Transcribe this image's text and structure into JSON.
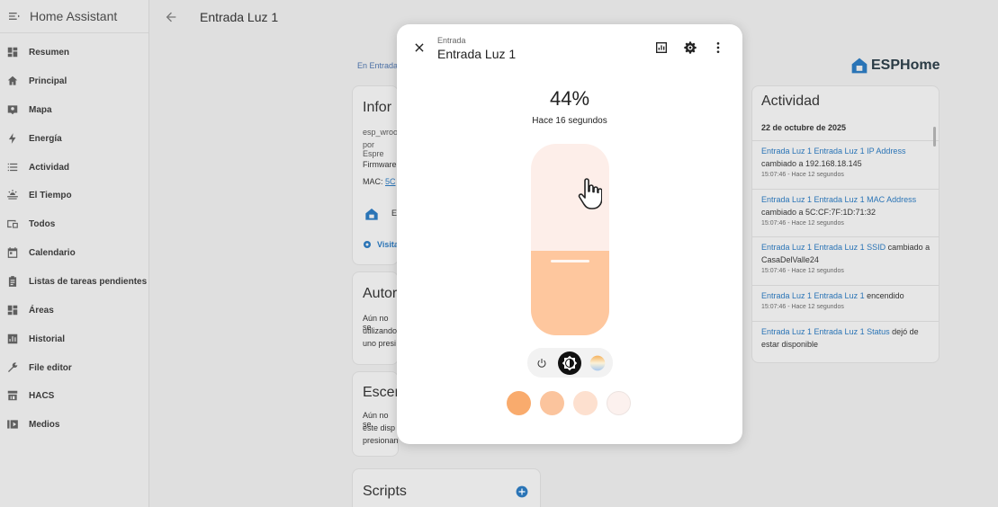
{
  "app": {
    "title": "Home Assistant",
    "page_title": "Entrada Luz 1"
  },
  "sidebar": {
    "items": [
      {
        "label": "Resumen",
        "icon": "dashboard-icon"
      },
      {
        "label": "Principal",
        "icon": "home-icon"
      },
      {
        "label": "Mapa",
        "icon": "map-icon"
      },
      {
        "label": "Energía",
        "icon": "lightning-icon"
      },
      {
        "label": "Actividad",
        "icon": "list-icon"
      },
      {
        "label": "El Tiempo",
        "icon": "weather-icon"
      },
      {
        "label": "Todos",
        "icon": "devices-icon"
      },
      {
        "label": "Calendario",
        "icon": "calendar-icon"
      },
      {
        "label": "Listas de tareas pendientes",
        "icon": "clipboard-icon"
      },
      {
        "label": "Áreas",
        "icon": "grid-icon"
      },
      {
        "label": "Historial",
        "icon": "chart-icon"
      },
      {
        "label": "File editor",
        "icon": "wrench-icon"
      },
      {
        "label": "HACS",
        "icon": "store-icon"
      },
      {
        "label": "Medios",
        "icon": "media-icon"
      }
    ]
  },
  "background": {
    "breadcrumb": "En Entrada",
    "info_card": {
      "title": "Infor",
      "line1": "esp_wroo",
      "line2": "por Espre",
      "firmware_label": "Firmware",
      "mac_label": "MAC:",
      "mac_value": "5C",
      "device_label": "E",
      "visit_label": "Visita"
    },
    "automations_card": {
      "title": "Autor",
      "lines": [
        "Aún no se",
        "utilizando",
        "uno presi"
      ]
    },
    "scenes_card": {
      "title": "Escer",
      "lines": [
        "Aún no se",
        "este disp",
        "presionan"
      ]
    },
    "scripts_card": {
      "title": "Scripts"
    },
    "brand": "ESPHome",
    "activity": {
      "title": "Actividad",
      "date": "22 de octubre de 2025",
      "entries": [
        {
          "link": "Entrada Luz 1 Entrada Luz 1 IP Address",
          "text": "cambiado a 192.168.18.145",
          "time": "15:07:46 - Hace 12 segundos"
        },
        {
          "link": "Entrada Luz 1 Entrada Luz 1 MAC Address",
          "text": "cambiado a 5C:CF:7F:1D:71:32",
          "time": "15:07:46 - Hace 12 segundos"
        },
        {
          "link": "Entrada Luz 1 Entrada Luz 1 SSID",
          "text": "cambiado a CasaDelValle24",
          "time": "15:07:46 - Hace 12 segundos"
        },
        {
          "link": "Entrada Luz 1 Entrada Luz 1",
          "text": "encendido",
          "time": "15:07:46 - Hace 12 segundos"
        },
        {
          "link": "Entrada Luz 1 Entrada Luz 1 Status",
          "text": "dejó de estar disponible",
          "time": ""
        }
      ]
    }
  },
  "dialog": {
    "subtitle": "Entrada",
    "title": "Entrada Luz 1",
    "brightness_text": "44%",
    "brightness_fraction": 0.44,
    "last_changed": "Hace 16 segundos",
    "slider_track_color": "#fdeee9",
    "slider_fill_color": "#fec79e",
    "swatches": [
      "#f9ab6d",
      "#fbc49d",
      "#fde0cf",
      "#fcf1ee"
    ],
    "icons": {
      "close": "close-icon",
      "history": "chart-icon",
      "settings": "gear-icon",
      "more": "more-vert-icon"
    }
  }
}
